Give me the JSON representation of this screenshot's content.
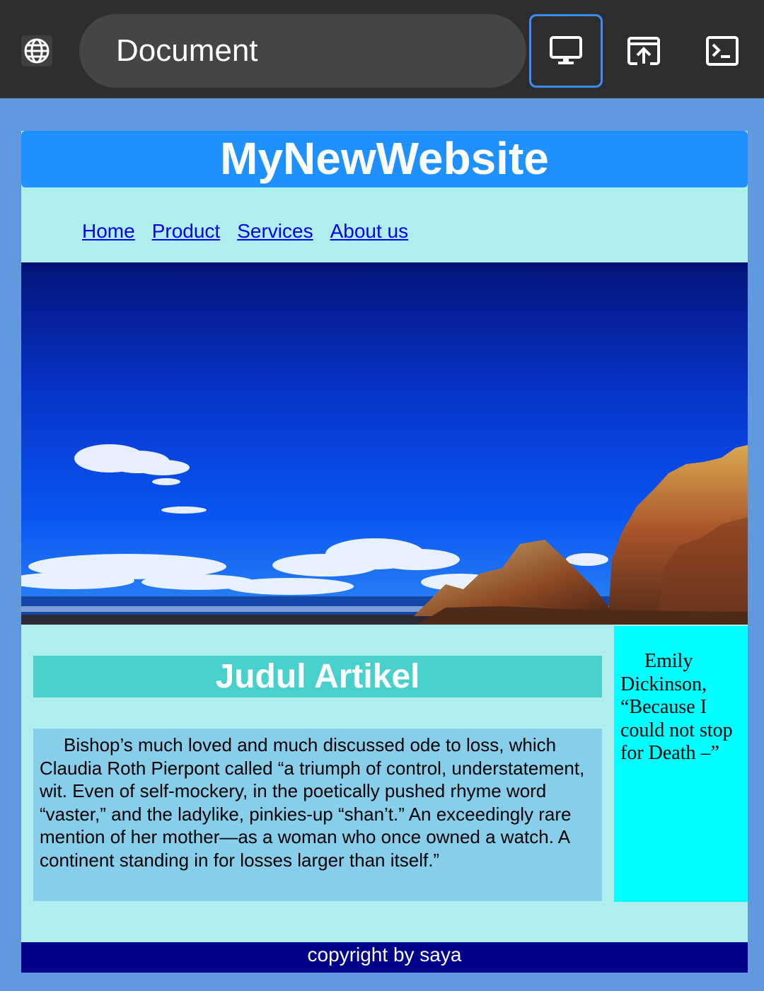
{
  "browser": {
    "url_title": "Document",
    "icons": [
      "globe-icon",
      "desktop-icon",
      "open-in-browser-icon",
      "terminal-icon"
    ]
  },
  "site": {
    "title": "MyNewWebsite",
    "nav": [
      "Home",
      "Product",
      "Services",
      "About us"
    ],
    "hero_image": "sky-and-rocky-coast-photo"
  },
  "article": {
    "title": "Judul Artikel",
    "body": "Bishop’s much loved and much discussed ode to loss, which Claudia Roth Pierpont called “a triumph of control, understatement, wit. Even of self-mockery, in the poetically pushed rhyme word “vaster,” and the ladylike, pinkies-up “shan’t.” An exceedingly rare mention of her mother—as a woman who once owned a watch. A continent standing in for losses larger than itself.”"
  },
  "aside": {
    "text": "Emily Dickinson, “Because I could not stop for Death –”"
  },
  "footer": {
    "text": "copyright by saya"
  },
  "colors": {
    "browser_bar": "#2E2E2E",
    "page_background": "#6199DF",
    "header": "#1E90FF",
    "content": "#AFEEEE",
    "article_title": "#48D1CC",
    "article_body": "#87CEEB",
    "aside": "#00FFFF",
    "footer": "#00008B"
  }
}
